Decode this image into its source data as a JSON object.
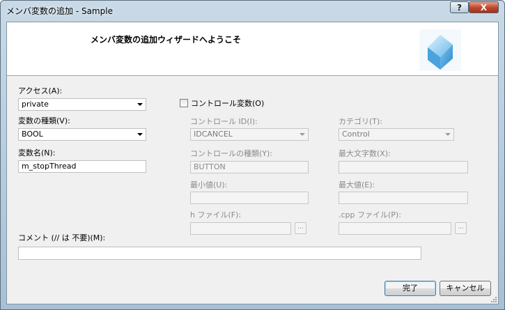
{
  "window": {
    "title": "メンバ変数の追加 - Sample",
    "help_label": "?",
    "close_label": "X"
  },
  "header": {
    "title": "メンバ変数の追加ウィザードへようこそ"
  },
  "form": {
    "access": {
      "label": "アクセス(A):",
      "value": "private"
    },
    "var_type": {
      "label": "変数の種類(V):",
      "value": "BOOL"
    },
    "var_name": {
      "label": "変数名(N):",
      "value": "m_stopThread"
    },
    "control_var": {
      "label": "コントロール変数(O)",
      "checked": false
    },
    "control_id": {
      "label": "コントロール ID(I):",
      "value": "IDCANCEL"
    },
    "category": {
      "label": "カテゴリ(T):",
      "value": "Control"
    },
    "control_type": {
      "label": "コントロールの種類(Y):",
      "value": "BUTTON"
    },
    "max_chars": {
      "label": "最大文字数(X):",
      "value": ""
    },
    "min_value": {
      "label": "最小値(U):",
      "value": ""
    },
    "max_value": {
      "label": "最大値(E):",
      "value": ""
    },
    "h_file": {
      "label": "h ファイル(F):",
      "value": "",
      "browse_label": "..."
    },
    "cpp_file": {
      "label": ".cpp ファイル(P):",
      "value": "",
      "browse_label": "..."
    },
    "comment": {
      "label": "コメント (// は 不要)(M):",
      "value": ""
    }
  },
  "buttons": {
    "finish": "完了",
    "cancel": "キャンセル"
  }
}
